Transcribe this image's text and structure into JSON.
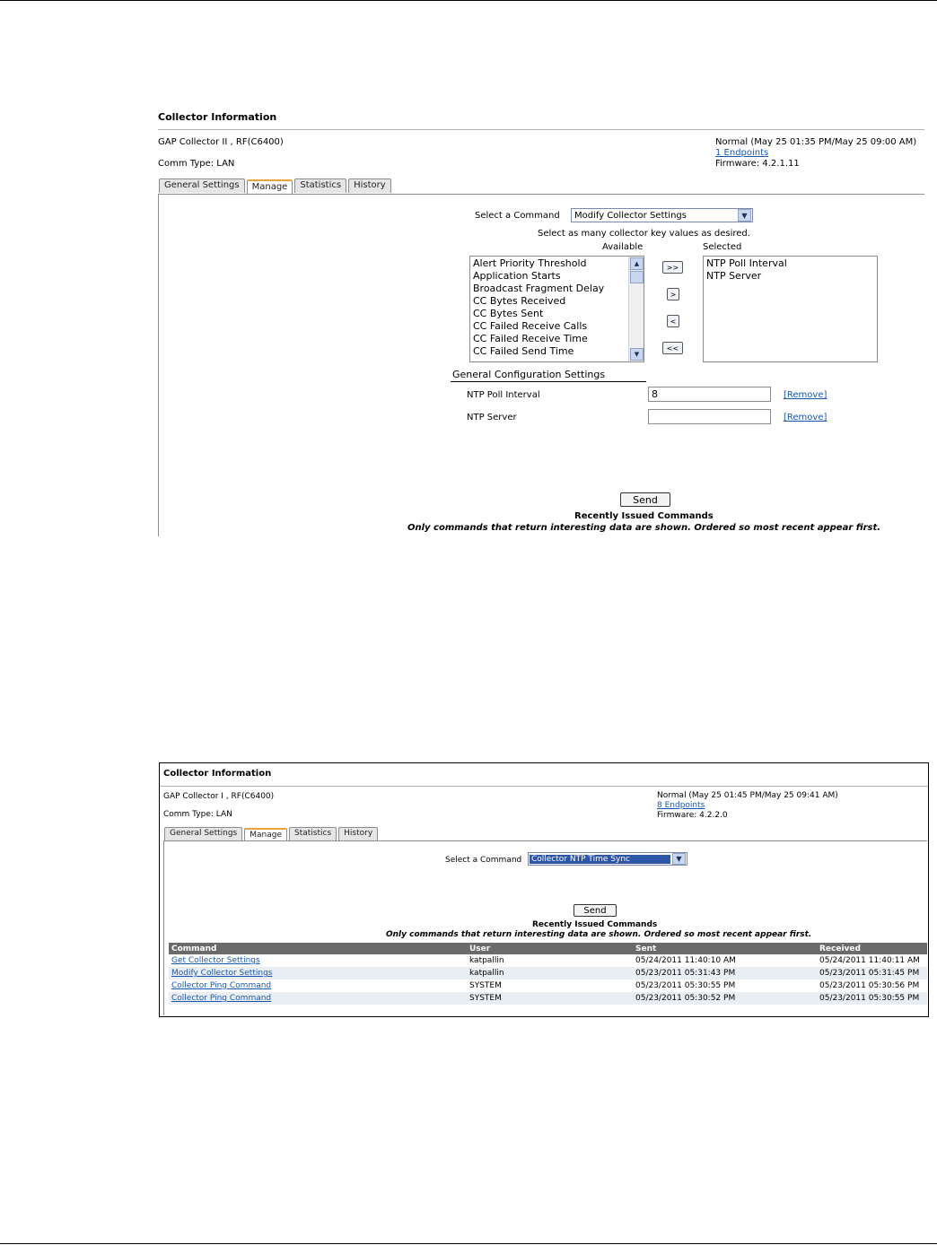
{
  "screen1": {
    "title": "Collector Information",
    "collector_name": "GAP Collector II , RF(C6400)",
    "comm_type": "Comm Type: LAN",
    "status": "Normal (May 25 01:35 PM/May 25 09:00 AM)",
    "endpoints_link": "1 Endpoints",
    "firmware": "Firmware: 4.2.1.11",
    "tabs": [
      "General Settings",
      "Manage",
      "Statistics",
      "History"
    ],
    "active_tab": "Manage",
    "select_command_label": "Select a Command",
    "select_command_value": "Modify Collector Settings",
    "instruction": "Select as many collector key values as desired.",
    "available_label": "Available",
    "selected_label": "Selected",
    "available_items": [
      "Alert Priority Threshold",
      "Application Starts",
      "Broadcast Fragment Delay",
      "CC Bytes Received",
      "CC Bytes Sent",
      "CC Failed Receive Calls",
      "CC Failed Receive Time",
      "CC Failed Send Time"
    ],
    "selected_items": [
      "NTP Poll Interval",
      "NTP Server"
    ],
    "move_buttons": [
      ">>",
      ">",
      "<",
      "<<"
    ],
    "section_heading": "General Configuration Settings",
    "fields": [
      {
        "label": "NTP Poll Interval",
        "value": "8",
        "remove": "[Remove]"
      },
      {
        "label": "NTP Server",
        "value": "",
        "remove": "[Remove]"
      }
    ],
    "send_label": "Send",
    "recent_heading": "Recently Issued Commands",
    "recent_note": "Only commands that return interesting data are shown. Ordered so most recent appear first."
  },
  "screen2": {
    "title": "Collector Information",
    "collector_name": "GAP Collector I , RF(C6400)",
    "comm_type": "Comm Type: LAN",
    "status": "Normal (May 25 01:45 PM/May 25 09:41 AM)",
    "endpoints_link": "8 Endpoints",
    "firmware": "Firmware: 4.2.2.0",
    "tabs": [
      "General Settings",
      "Manage",
      "Statistics",
      "History"
    ],
    "active_tab": "Manage",
    "select_command_label": "Select a Command",
    "select_command_value": "Collector NTP Time Sync",
    "send_label": "Send",
    "recent_heading": "Recently Issued Commands",
    "recent_note": "Only commands that return interesting data are shown. Ordered so most recent appear first.",
    "table": {
      "headers": [
        "Command",
        "User",
        "Sent",
        "Received"
      ],
      "rows": [
        [
          "Get Collector Settings",
          "katpallin",
          "05/24/2011 11:40:10 AM",
          "05/24/2011 11:40:11 AM"
        ],
        [
          "Modify Collector Settings",
          "katpallin",
          "05/23/2011 05:31:43 PM",
          "05/23/2011 05:31:45 PM"
        ],
        [
          "Collector Ping Command",
          "SYSTEM",
          "05/23/2011 05:30:55 PM",
          "05/23/2011 05:30:56 PM"
        ],
        [
          "Collector Ping Command",
          "SYSTEM",
          "05/23/2011 05:30:52 PM",
          "05/23/2011 05:30:55 PM"
        ]
      ]
    }
  }
}
